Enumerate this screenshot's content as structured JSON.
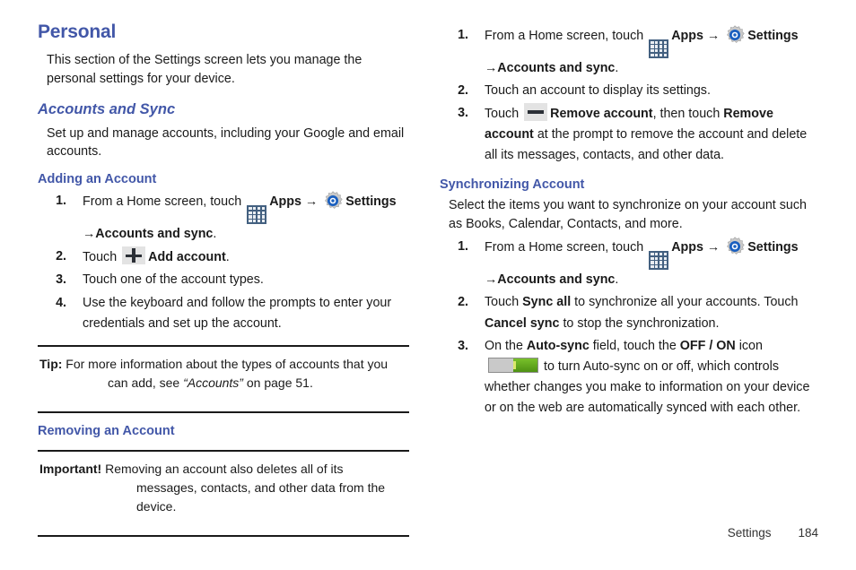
{
  "document": {
    "type": "user-manual-page",
    "accent_color": "#4257a8",
    "text_color": "#1a1a1a"
  },
  "left_column": {
    "section_heading": "Personal",
    "intro": "This section of the Settings screen lets you manage the personal settings for your device.",
    "subsection_heading": "Accounts and Sync",
    "subsection_intro": "Set up and manage accounts, including your Google and email accounts.",
    "task_adding": {
      "heading": "Adding an Account",
      "steps": {
        "step1": {
          "num": "1.",
          "part1": "From a Home screen, touch",
          "apps_label": "Apps",
          "arrow1": "→",
          "settings_label": "Settings",
          "arrow2": "→",
          "path_label": "Accounts and sync",
          "period": "."
        },
        "step2": {
          "num": "2.",
          "part1": "Touch",
          "action_label": "Add account",
          "period": "."
        },
        "step3": {
          "num": "3.",
          "text": "Touch one of the account types."
        },
        "step4": {
          "num": "4.",
          "text": "Use the keyboard and follow the prompts to enter your credentials and set up the account."
        }
      }
    },
    "tip": {
      "label": "Tip:",
      "text_before": "For more information about the types of accounts that you can add, see",
      "reference": "“Accounts”",
      "text_after": "on page 51."
    },
    "task_removing": {
      "heading": "Removing an Account"
    },
    "important": {
      "label": "Important!",
      "text": "Removing an account also deletes all of its messages, contacts, and other data from the device."
    }
  },
  "right_column": {
    "removing_steps": {
      "step1": {
        "num": "1.",
        "part1": "From a Home screen, touch",
        "apps_label": "Apps",
        "arrow1": "→",
        "settings_label": "Settings",
        "arrow2": "→",
        "path_label": "Accounts and sync",
        "period": "."
      },
      "step2": {
        "num": "2.",
        "text": "Touch an account to display its settings."
      },
      "step3": {
        "num": "3.",
        "part1": "Touch",
        "action_label": "Remove account",
        "part2": ", then touch",
        "confirm_label": "Remove account",
        "part3": "at the prompt to remove the account and delete all its messages, contacts, and other data."
      }
    },
    "task_sync": {
      "heading": "Synchronizing Account",
      "intro": "Select the items you want to synchronize on your account such as Books, Calendar, Contacts, and more.",
      "steps": {
        "step1": {
          "num": "1.",
          "part1": "From a Home screen, touch",
          "apps_label": "Apps",
          "arrow1": "→",
          "settings_label": "Settings",
          "arrow2": "→",
          "path_label": "Accounts and sync",
          "period": "."
        },
        "step2": {
          "num": "2.",
          "part1": "Touch",
          "action_label": "Sync all",
          "part2": "to synchronize all your accounts. Touch",
          "cancel_label": "Cancel sync",
          "part3": "to stop the synchronization."
        },
        "step3": {
          "num": "3.",
          "part1": "On the",
          "field_label": "Auto-sync",
          "part2": "field, touch the",
          "toggle_label": "OFF / ON",
          "part3": "icon",
          "part4": "to turn Auto-sync on or off, which controls whether changes you make to information on your device or on the web are automatically synced with each other."
        }
      }
    }
  },
  "footer": {
    "label": "Settings",
    "page_number": "184"
  },
  "icons": {
    "apps": "apps-grid-icon",
    "settings": "settings-gear-icon",
    "add": "plus-icon",
    "remove": "minus-icon",
    "toggle": "off-on-toggle-icon"
  }
}
